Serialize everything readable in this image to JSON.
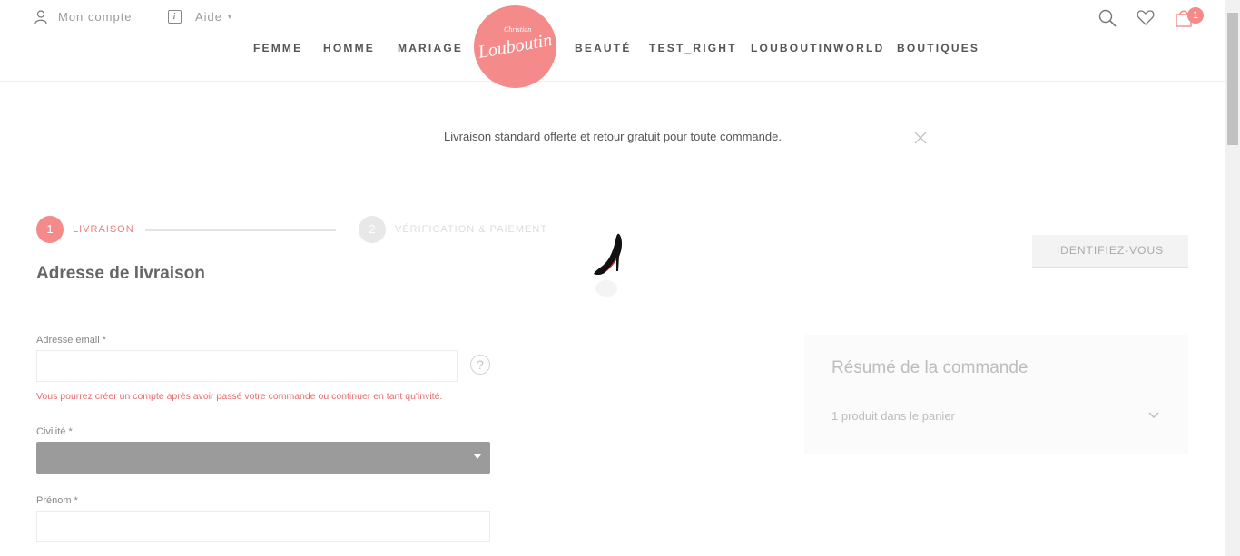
{
  "header": {
    "account_label": "Mon compte",
    "help_label": "Aide",
    "logo_small": "Christian",
    "logo_script": "Louboutin",
    "nav_left": [
      "FEMME",
      "HOMME",
      "MARIAGE"
    ],
    "nav_right": [
      "BEAUTÉ",
      "TEST_RIGHT",
      "LOUBOUTINWORLD",
      "BOUTIQUES"
    ],
    "cart_count": "1",
    "icons": [
      "user-icon",
      "info-icon",
      "search-icon",
      "heart-icon",
      "bag-icon"
    ]
  },
  "banner": {
    "text": "Livraison standard offerte et retour gratuit pour toute commande."
  },
  "steps": [
    {
      "number": "1",
      "label": "LIVRAISON",
      "active": true
    },
    {
      "number": "2",
      "label": "VÉRIFICATION & PAIEMENT",
      "active": false
    }
  ],
  "form": {
    "section_title": "Adresse de livraison",
    "email_label": "Adresse email *",
    "email_value": "",
    "email_help": "?",
    "email_note": "Vous pourrez créer un compte après avoir passé votre commande ou continuer en tant qu'invité.",
    "civility_label": "Civilité *",
    "civility_value": "",
    "firstname_label": "Prénom *",
    "firstname_value": ""
  },
  "login_button": "IDENTIFIEZ-VOUS",
  "summary": {
    "title": "Résumé de la commande",
    "products": "1 produit dans le panier"
  },
  "colors": {
    "accent": "#f58a8a",
    "select_bg": "#9b9b9b"
  }
}
